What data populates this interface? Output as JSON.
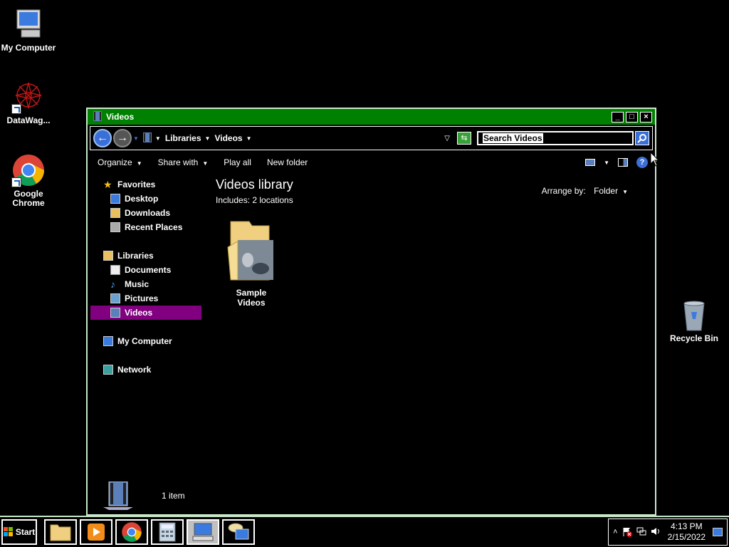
{
  "desktop": {
    "icons": [
      {
        "label": "My Computer"
      },
      {
        "label": "DataWag..."
      },
      {
        "label": "Google Chrome"
      },
      {
        "label": "Recycle Bin"
      }
    ]
  },
  "window": {
    "title": "Videos",
    "breadcrumb": [
      "Libraries",
      "Videos"
    ],
    "search_placeholder": "Search Videos",
    "commands": [
      {
        "label": "Organize",
        "has_menu": true
      },
      {
        "label": "Share with",
        "has_menu": true
      },
      {
        "label": "Play all",
        "has_menu": false
      },
      {
        "label": "New folder",
        "has_menu": false
      }
    ],
    "help_label": "?",
    "nav": {
      "favorites": {
        "label": "Favorites",
        "items": [
          "Desktop",
          "Downloads",
          "Recent Places"
        ]
      },
      "libraries": {
        "label": "Libraries",
        "items": [
          "Documents",
          "Music",
          "Pictures",
          "Videos"
        ]
      },
      "computer": {
        "label": "My Computer"
      },
      "network": {
        "label": "Network"
      }
    },
    "library_title": "Videos library",
    "library_sub": "Includes:  2 locations",
    "arrange_label": "Arrange by:",
    "arrange_value": "Folder",
    "folders": [
      {
        "label": "Sample Videos"
      }
    ],
    "status_count": "1 item"
  },
  "taskbar": {
    "start_label": "Start",
    "clock_time": "4:13 PM",
    "clock_date": "2/15/2022"
  },
  "colors": {
    "titlebar": "#008000",
    "selection": "#800080",
    "border": "#c8e8c8"
  }
}
